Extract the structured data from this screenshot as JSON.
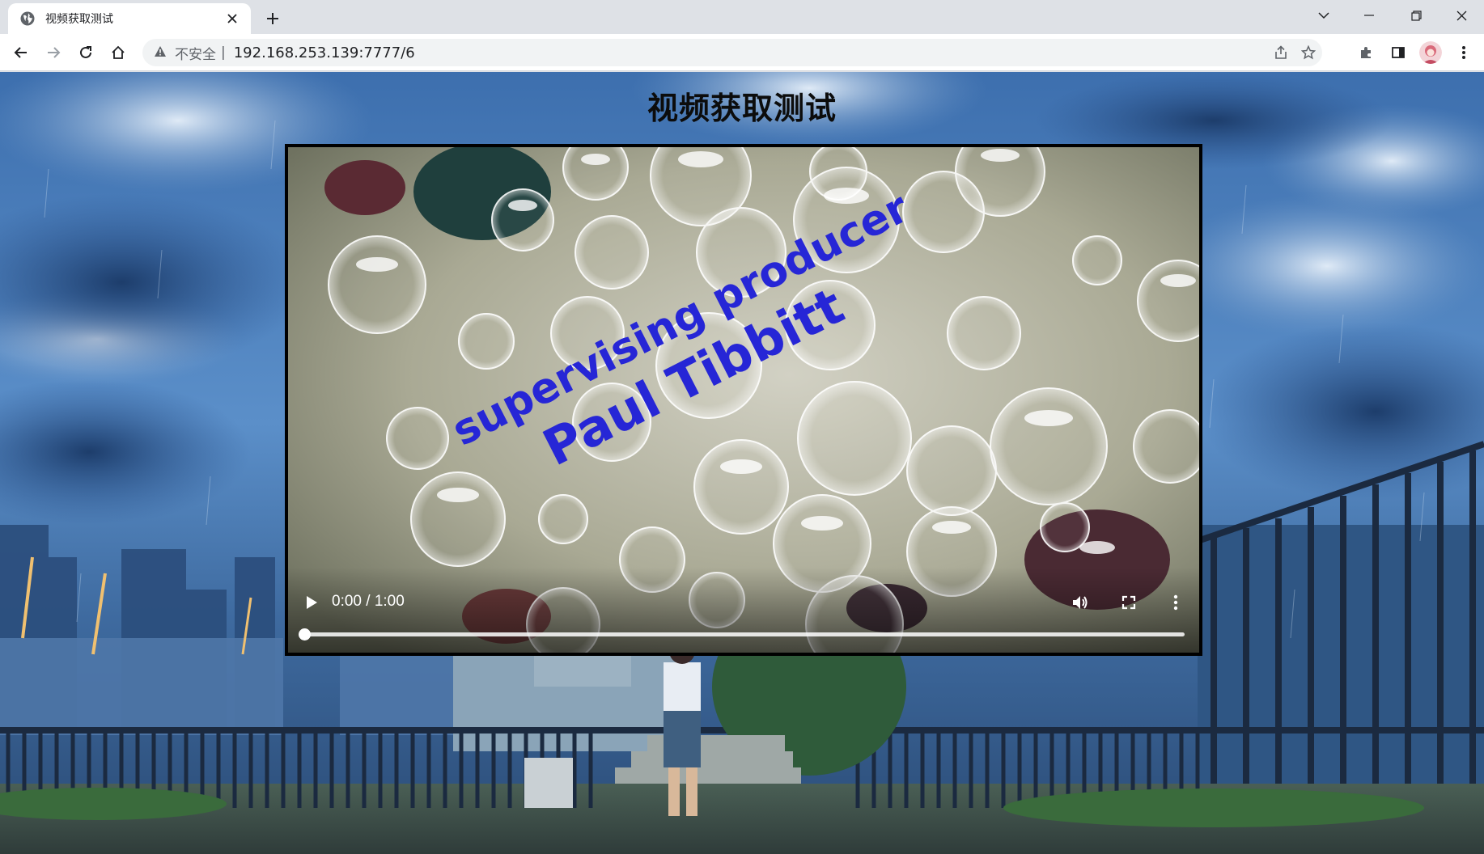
{
  "browser": {
    "tab": {
      "title": "视频获取测试",
      "favicon": "globe-icon",
      "close": "close-icon"
    },
    "new_tab": "plus-icon",
    "window_controls": [
      "chevron-down-icon",
      "minimize-icon",
      "restore-icon",
      "close-icon"
    ],
    "nav": [
      "back-icon",
      "forward-icon",
      "reload-icon",
      "home-icon"
    ],
    "address": {
      "security_icon": "warning-triangle-icon",
      "security_text": "不安全",
      "separator": "|",
      "url": "192.168.253.139:7777/6"
    },
    "omnibox_actions": [
      "share-icon",
      "star-icon"
    ],
    "toolbar_actions": [
      "extensions-icon",
      "side-panel-icon",
      "profile-avatar",
      "menu-icon"
    ]
  },
  "page": {
    "title": "视频获取测试",
    "background": "anime-rain-rooftop-scene"
  },
  "video": {
    "frame_subject": "bubbles-credits-frame",
    "credit_lines": [
      "supervising producer",
      "Paul Tibbitt"
    ],
    "current_time": "0:00",
    "duration": "1:00",
    "time_display": "0:00 / 1:00",
    "progress": 0,
    "controls": [
      "play-icon",
      "volume-icon",
      "fullscreen-icon",
      "more-options-icon"
    ]
  },
  "colors": {
    "tabstrip": "#dee1e6",
    "toolbar": "#ffffff",
    "omnibox": "#f1f3f4",
    "credit_text": "#2a2ad8",
    "title_text": "#0c0c0c"
  }
}
